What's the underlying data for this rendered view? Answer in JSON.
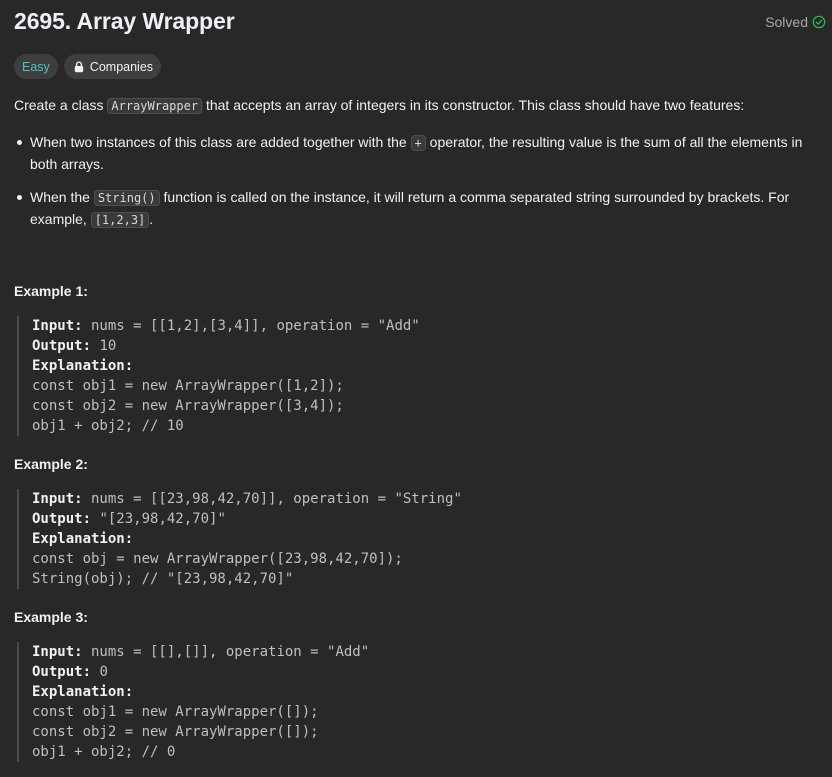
{
  "problem": {
    "title": "2695. Array Wrapper",
    "status": "Solved",
    "difficulty": "Easy",
    "companies_label": "Companies"
  },
  "description": {
    "intro_1": "Create a class ",
    "intro_code": "ArrayWrapper",
    "intro_2": " that accepts an array of integers in its constructor. This class should have two features:",
    "bullet1_a": "When two instances of this class are added together with the ",
    "bullet1_code": "+",
    "bullet1_b": " operator, the resulting value is the sum of all the elements in both arrays.",
    "bullet2_a": "When the ",
    "bullet2_code": "String()",
    "bullet2_b": " function is called on the instance, it will return a comma separated string surrounded by brackets. For example, ",
    "bullet2_code2": "[1,2,3]",
    "bullet2_c": "."
  },
  "labels": {
    "input": "Input:",
    "output": "Output:",
    "explanation": "Explanation:"
  },
  "examples": [
    {
      "title": "Example 1:",
      "input": " nums = [[1,2],[3,4]], operation = \"Add\"",
      "output": " 10",
      "code": [
        "const obj1 = new ArrayWrapper([1,2]);",
        "const obj2 = new ArrayWrapper([3,4]);",
        "obj1 + obj2; // 10"
      ]
    },
    {
      "title": "Example 2:",
      "input": " nums = [[23,98,42,70]], operation = \"String\"",
      "output": " \"[23,98,42,70]\"",
      "code": [
        "const obj = new ArrayWrapper([23,98,42,70]);",
        "String(obj); // \"[23,98,42,70]\""
      ]
    },
    {
      "title": "Example 3:",
      "input": " nums = [[],[]], operation = \"Add\"",
      "output": " 0",
      "code": [
        "const obj1 = new ArrayWrapper([]);",
        "const obj2 = new ArrayWrapper([]);",
        "obj1 + obj2; // 0"
      ]
    }
  ],
  "colors": {
    "background": "#282828",
    "easy": "#46c6c2",
    "solved_check": "#2cbb5d"
  }
}
